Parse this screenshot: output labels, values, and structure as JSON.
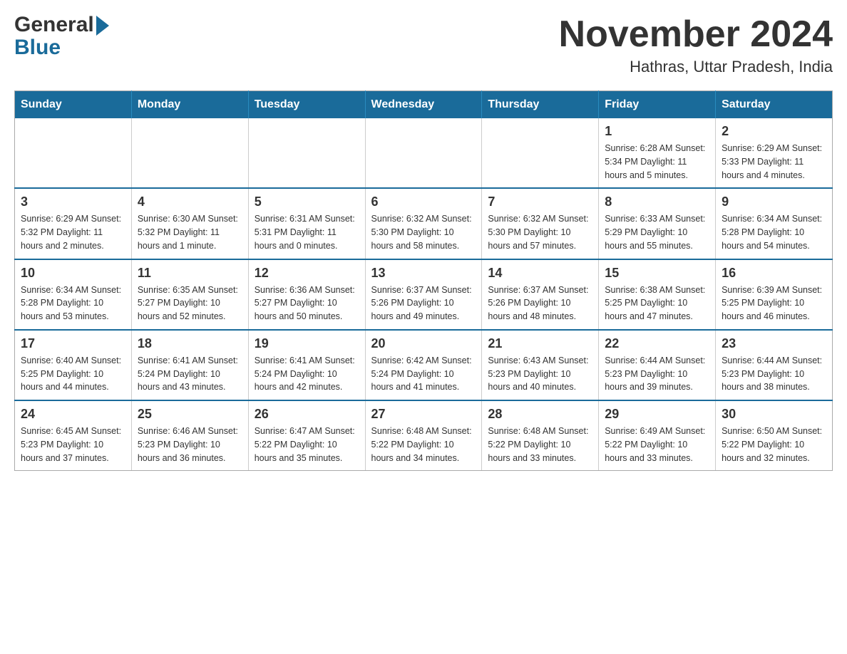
{
  "header": {
    "logo_general": "General",
    "logo_blue": "Blue",
    "title": "November 2024",
    "subtitle": "Hathras, Uttar Pradesh, India"
  },
  "calendar": {
    "days_of_week": [
      "Sunday",
      "Monday",
      "Tuesday",
      "Wednesday",
      "Thursday",
      "Friday",
      "Saturday"
    ],
    "weeks": [
      {
        "days": [
          {
            "date": "",
            "info": ""
          },
          {
            "date": "",
            "info": ""
          },
          {
            "date": "",
            "info": ""
          },
          {
            "date": "",
            "info": ""
          },
          {
            "date": "",
            "info": ""
          },
          {
            "date": "1",
            "info": "Sunrise: 6:28 AM\nSunset: 5:34 PM\nDaylight: 11 hours and 5 minutes."
          },
          {
            "date": "2",
            "info": "Sunrise: 6:29 AM\nSunset: 5:33 PM\nDaylight: 11 hours and 4 minutes."
          }
        ]
      },
      {
        "days": [
          {
            "date": "3",
            "info": "Sunrise: 6:29 AM\nSunset: 5:32 PM\nDaylight: 11 hours and 2 minutes."
          },
          {
            "date": "4",
            "info": "Sunrise: 6:30 AM\nSunset: 5:32 PM\nDaylight: 11 hours and 1 minute."
          },
          {
            "date": "5",
            "info": "Sunrise: 6:31 AM\nSunset: 5:31 PM\nDaylight: 11 hours and 0 minutes."
          },
          {
            "date": "6",
            "info": "Sunrise: 6:32 AM\nSunset: 5:30 PM\nDaylight: 10 hours and 58 minutes."
          },
          {
            "date": "7",
            "info": "Sunrise: 6:32 AM\nSunset: 5:30 PM\nDaylight: 10 hours and 57 minutes."
          },
          {
            "date": "8",
            "info": "Sunrise: 6:33 AM\nSunset: 5:29 PM\nDaylight: 10 hours and 55 minutes."
          },
          {
            "date": "9",
            "info": "Sunrise: 6:34 AM\nSunset: 5:28 PM\nDaylight: 10 hours and 54 minutes."
          }
        ]
      },
      {
        "days": [
          {
            "date": "10",
            "info": "Sunrise: 6:34 AM\nSunset: 5:28 PM\nDaylight: 10 hours and 53 minutes."
          },
          {
            "date": "11",
            "info": "Sunrise: 6:35 AM\nSunset: 5:27 PM\nDaylight: 10 hours and 52 minutes."
          },
          {
            "date": "12",
            "info": "Sunrise: 6:36 AM\nSunset: 5:27 PM\nDaylight: 10 hours and 50 minutes."
          },
          {
            "date": "13",
            "info": "Sunrise: 6:37 AM\nSunset: 5:26 PM\nDaylight: 10 hours and 49 minutes."
          },
          {
            "date": "14",
            "info": "Sunrise: 6:37 AM\nSunset: 5:26 PM\nDaylight: 10 hours and 48 minutes."
          },
          {
            "date": "15",
            "info": "Sunrise: 6:38 AM\nSunset: 5:25 PM\nDaylight: 10 hours and 47 minutes."
          },
          {
            "date": "16",
            "info": "Sunrise: 6:39 AM\nSunset: 5:25 PM\nDaylight: 10 hours and 46 minutes."
          }
        ]
      },
      {
        "days": [
          {
            "date": "17",
            "info": "Sunrise: 6:40 AM\nSunset: 5:25 PM\nDaylight: 10 hours and 44 minutes."
          },
          {
            "date": "18",
            "info": "Sunrise: 6:41 AM\nSunset: 5:24 PM\nDaylight: 10 hours and 43 minutes."
          },
          {
            "date": "19",
            "info": "Sunrise: 6:41 AM\nSunset: 5:24 PM\nDaylight: 10 hours and 42 minutes."
          },
          {
            "date": "20",
            "info": "Sunrise: 6:42 AM\nSunset: 5:24 PM\nDaylight: 10 hours and 41 minutes."
          },
          {
            "date": "21",
            "info": "Sunrise: 6:43 AM\nSunset: 5:23 PM\nDaylight: 10 hours and 40 minutes."
          },
          {
            "date": "22",
            "info": "Sunrise: 6:44 AM\nSunset: 5:23 PM\nDaylight: 10 hours and 39 minutes."
          },
          {
            "date": "23",
            "info": "Sunrise: 6:44 AM\nSunset: 5:23 PM\nDaylight: 10 hours and 38 minutes."
          }
        ]
      },
      {
        "days": [
          {
            "date": "24",
            "info": "Sunrise: 6:45 AM\nSunset: 5:23 PM\nDaylight: 10 hours and 37 minutes."
          },
          {
            "date": "25",
            "info": "Sunrise: 6:46 AM\nSunset: 5:23 PM\nDaylight: 10 hours and 36 minutes."
          },
          {
            "date": "26",
            "info": "Sunrise: 6:47 AM\nSunset: 5:22 PM\nDaylight: 10 hours and 35 minutes."
          },
          {
            "date": "27",
            "info": "Sunrise: 6:48 AM\nSunset: 5:22 PM\nDaylight: 10 hours and 34 minutes."
          },
          {
            "date": "28",
            "info": "Sunrise: 6:48 AM\nSunset: 5:22 PM\nDaylight: 10 hours and 33 minutes."
          },
          {
            "date": "29",
            "info": "Sunrise: 6:49 AM\nSunset: 5:22 PM\nDaylight: 10 hours and 33 minutes."
          },
          {
            "date": "30",
            "info": "Sunrise: 6:50 AM\nSunset: 5:22 PM\nDaylight: 10 hours and 32 minutes."
          }
        ]
      }
    ]
  }
}
